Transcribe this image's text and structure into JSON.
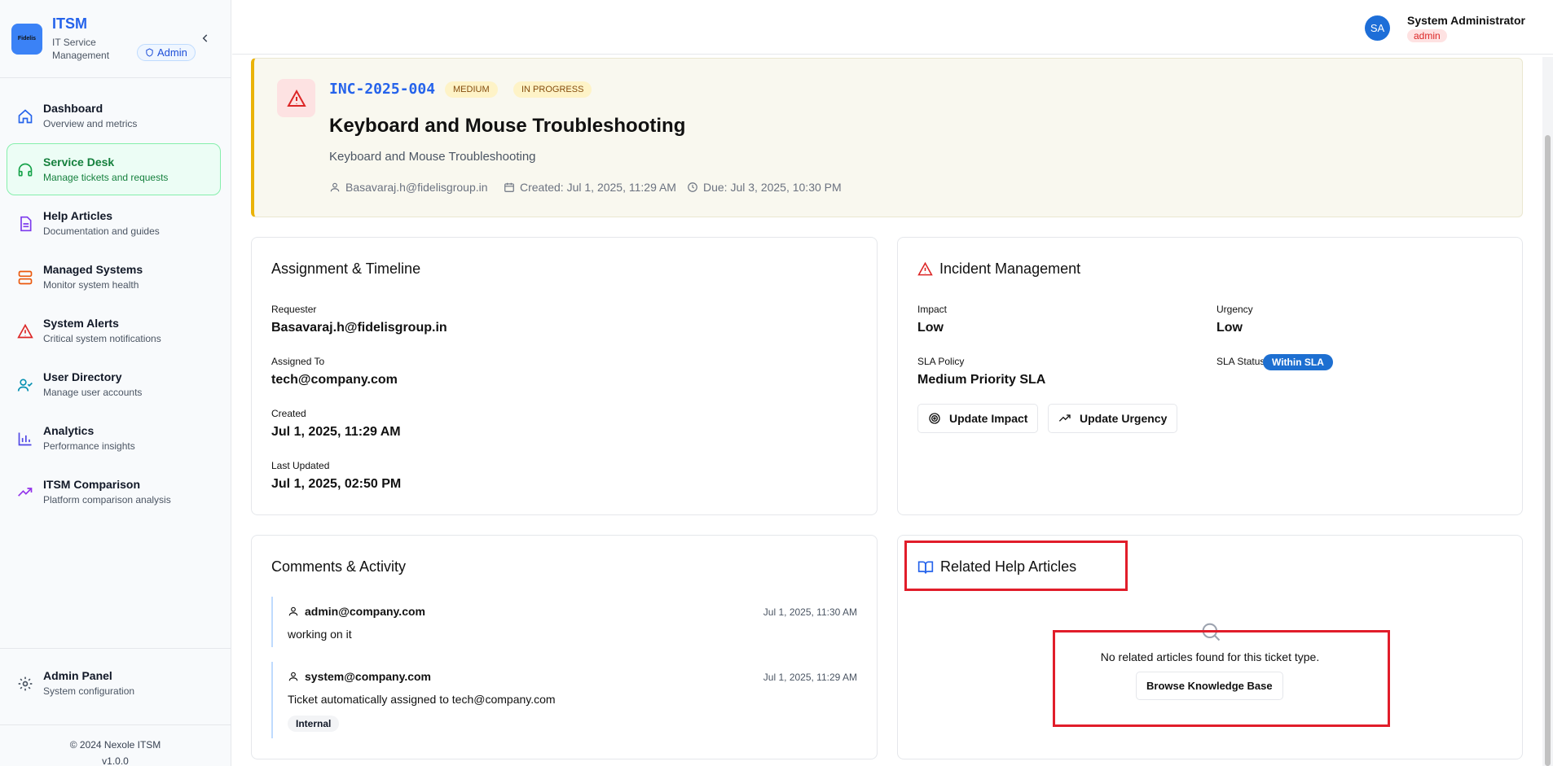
{
  "brand": {
    "logo_text": "Fidelis",
    "title": "ITSM",
    "subtitle": "IT Service Management",
    "admin_badge": "Admin"
  },
  "sidebar": {
    "items": [
      {
        "label": "Dashboard",
        "desc": "Overview and metrics",
        "icon": "home-icon",
        "color": "#2563eb",
        "active": false
      },
      {
        "label": "Service Desk",
        "desc": "Manage tickets and requests",
        "icon": "headset-icon",
        "color": "#16a34a",
        "active": true
      },
      {
        "label": "Help Articles",
        "desc": "Documentation and guides",
        "icon": "document-icon",
        "color": "#7c3aed",
        "active": false
      },
      {
        "label": "Managed Systems",
        "desc": "Monitor system health",
        "icon": "server-icon",
        "color": "#ea580c",
        "active": false
      },
      {
        "label": "System Alerts",
        "desc": "Critical system notifications",
        "icon": "alert-icon",
        "color": "#dc2626",
        "active": false
      },
      {
        "label": "User Directory",
        "desc": "Manage user accounts",
        "icon": "user-check-icon",
        "color": "#0891b2",
        "active": false
      },
      {
        "label": "Analytics",
        "desc": "Performance insights",
        "icon": "bar-chart-icon",
        "color": "#4f46e5",
        "active": false
      },
      {
        "label": "ITSM Comparison",
        "desc": "Platform comparison analysis",
        "icon": "trending-up-icon",
        "color": "#9333ea",
        "active": false
      }
    ],
    "admin_panel": {
      "label": "Admin Panel",
      "desc": "System configuration"
    },
    "footer": {
      "copyright": "© 2024 Nexole ITSM",
      "version": "v1.0.0"
    }
  },
  "header": {
    "avatar": "SA",
    "user_name": "System Administrator",
    "role": "admin"
  },
  "ticket": {
    "id": "INC-2025-004",
    "priority": "MEDIUM",
    "status": "IN PROGRESS",
    "title": "Keyboard and Mouse Troubleshooting",
    "description": "Keyboard and Mouse Troubleshooting",
    "requester": "Basavaraj.h@fidelisgroup.in",
    "created": "Created: Jul 1, 2025, 11:29 AM",
    "due": "Due: Jul 3, 2025, 10:30 PM"
  },
  "assignment": {
    "title": "Assignment & Timeline",
    "requester_label": "Requester",
    "requester": "Basavaraj.h@fidelisgroup.in",
    "assigned_label": "Assigned To",
    "assigned": "tech@company.com",
    "created_label": "Created",
    "created": "Jul 1, 2025, 11:29 AM",
    "updated_label": "Last Updated",
    "updated": "Jul 1, 2025, 02:50 PM"
  },
  "incident": {
    "title": "Incident Management",
    "impact_label": "Impact",
    "impact": "Low",
    "urgency_label": "Urgency",
    "urgency": "Low",
    "sla_policy_label": "SLA Policy",
    "sla_policy": "Medium Priority SLA",
    "sla_status_label": "SLA Status",
    "sla_status": "Within SLA",
    "update_impact": "Update Impact",
    "update_urgency": "Update Urgency"
  },
  "comments": {
    "title": "Comments & Activity",
    "items": [
      {
        "author": "admin@company.com",
        "time": "Jul 1, 2025, 11:30 AM",
        "text": "working on it"
      },
      {
        "author": "system@company.com",
        "time": "Jul 1, 2025, 11:29 AM",
        "text": "Ticket automatically assigned to tech@company.com",
        "tag": "Internal"
      }
    ]
  },
  "related": {
    "title": "Related Help Articles",
    "empty_text": "No related articles found for this ticket type.",
    "browse_button": "Browse Knowledge Base"
  }
}
